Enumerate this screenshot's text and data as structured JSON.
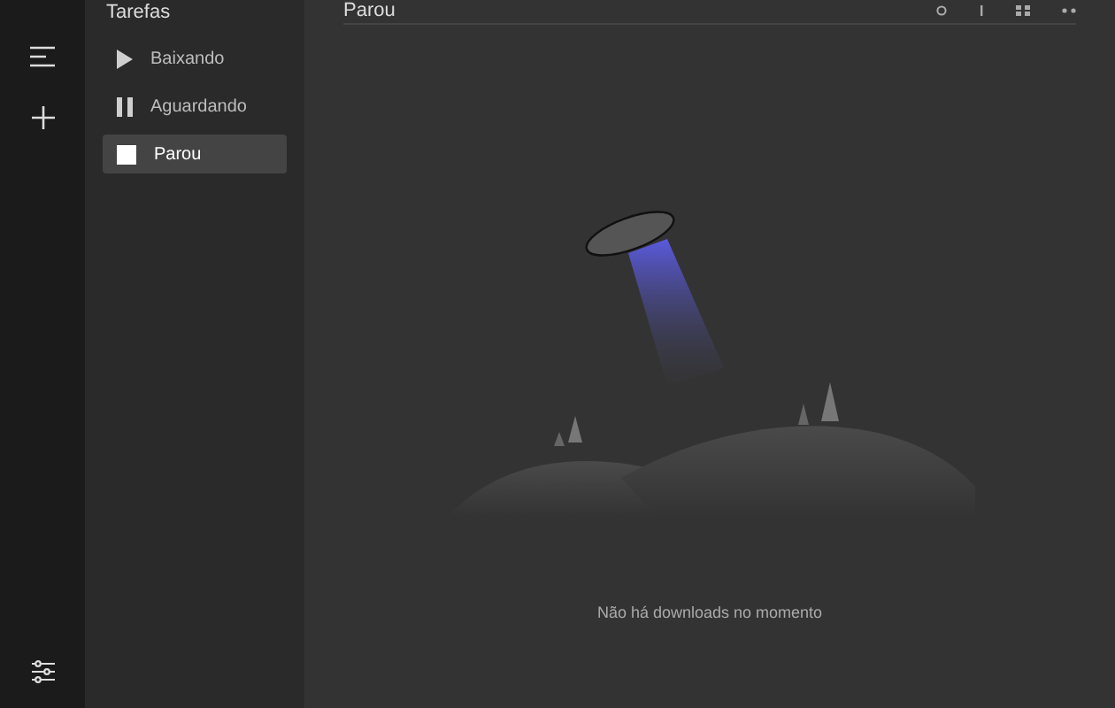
{
  "sidebar": {
    "title": "Tarefas",
    "items": [
      {
        "label": "Baixando",
        "kind": "play",
        "selected": false
      },
      {
        "label": "Aguardando",
        "kind": "pause",
        "selected": false
      },
      {
        "label": "Parou",
        "kind": "stop",
        "selected": true
      }
    ]
  },
  "main": {
    "title": "Parou",
    "empty_message": "Não há downloads no momento"
  }
}
